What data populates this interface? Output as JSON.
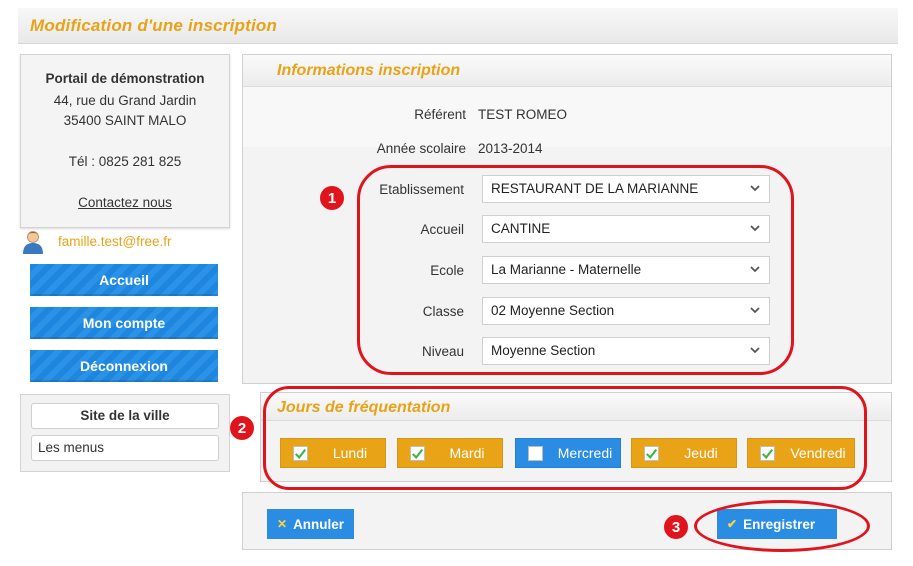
{
  "header": {
    "title": "Modification d'une inscription"
  },
  "sidebar": {
    "org_name": "Portail de démonstration",
    "address_line1": "44, rue du Grand Jardin",
    "address_line2": "35400 SAINT MALO",
    "phone": "Tél : 0825 281 825",
    "contact_link": "Contactez nous",
    "user_email": "famille.test@free.fr",
    "nav": [
      {
        "label": "Accueil"
      },
      {
        "label": "Mon compte"
      },
      {
        "label": "Déconnexion"
      }
    ],
    "city": {
      "title": "Site de la ville",
      "links": [
        {
          "label": "Les menus"
        }
      ]
    }
  },
  "info": {
    "title": "Informations inscription",
    "referent_label": "Référent",
    "referent_value": "TEST ROMEO",
    "annee_label": "Année scolaire",
    "annee_value": "2013-2014",
    "fields": [
      {
        "label": "Etablissement",
        "value": "RESTAURANT DE LA MARIANNE"
      },
      {
        "label": "Accueil",
        "value": "CANTINE"
      },
      {
        "label": "Ecole",
        "value": "La Marianne - Maternelle"
      },
      {
        "label": "Classe",
        "value": "02 Moyenne Section"
      },
      {
        "label": "Niveau",
        "value": "Moyenne Section"
      }
    ]
  },
  "days": {
    "title": "Jours de fréquentation",
    "items": [
      {
        "label": "Lundi",
        "checked": true
      },
      {
        "label": "Mardi",
        "checked": true
      },
      {
        "label": "Mercredi",
        "checked": false
      },
      {
        "label": "Jeudi",
        "checked": true
      },
      {
        "label": "Vendredi",
        "checked": true
      }
    ]
  },
  "actions": {
    "cancel_label": "Annuler",
    "save_label": "Enregistrer"
  },
  "callouts": [
    "1",
    "2",
    "3"
  ],
  "colors": {
    "accent": "#e8a317",
    "primary": "#2a8de3",
    "callout": "#e0141c"
  }
}
